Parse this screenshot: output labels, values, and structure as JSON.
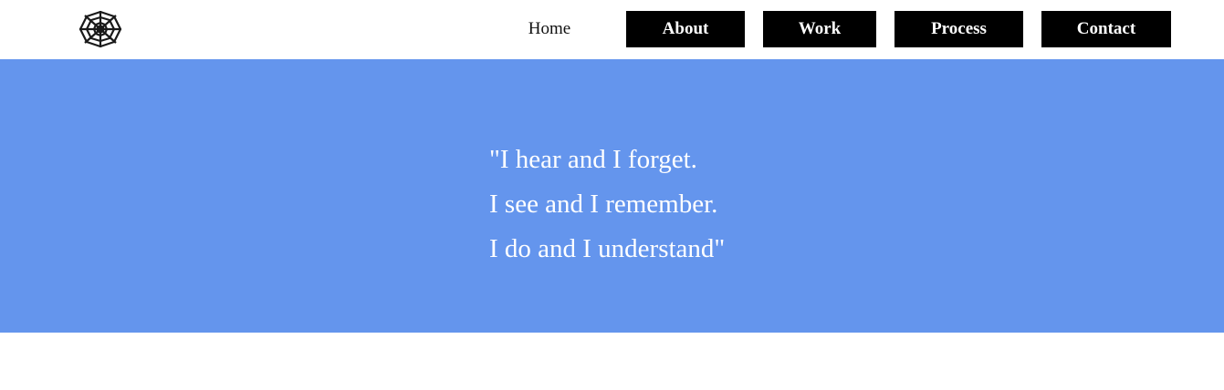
{
  "header": {
    "logo_icon": "spider-web-icon",
    "nav": {
      "home": "Home",
      "about": "About",
      "work": "Work",
      "process": "Process",
      "contact": "Contact"
    }
  },
  "hero": {
    "background_color": "#6495ED",
    "quote_lines": [
      "\"I hear and I forget.",
      "I see and I remember.",
      "I do and I understand\""
    ]
  },
  "colors": {
    "nav_button_bg": "#000000",
    "nav_button_text": "#ffffff",
    "hero_text": "#ffffff"
  }
}
